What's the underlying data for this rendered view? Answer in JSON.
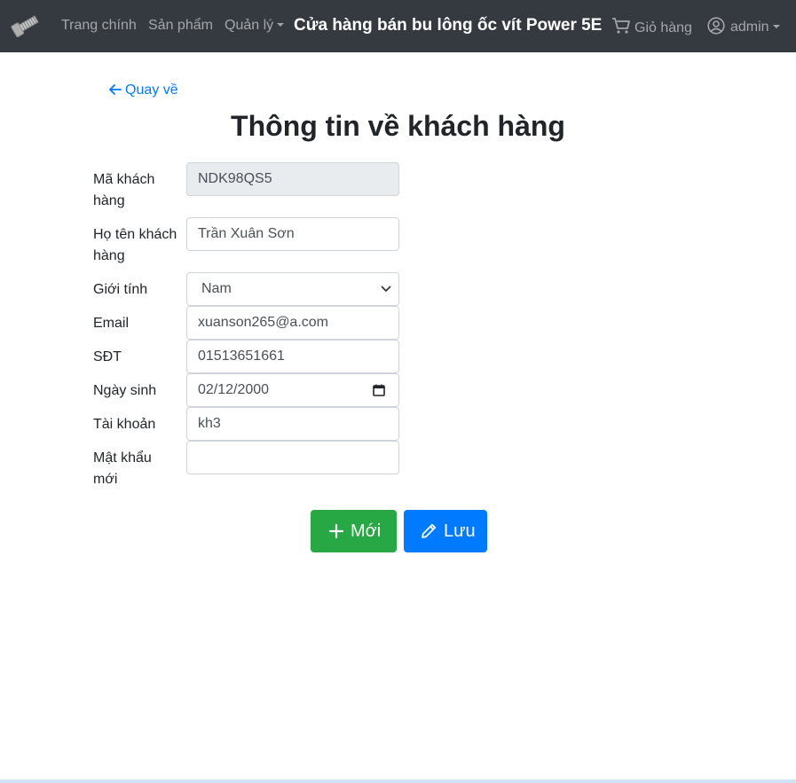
{
  "nav": {
    "home": "Trang chính",
    "products": "Sản phẩm",
    "manage": "Quản lý",
    "brand": "Cửa hàng bán bu lông ốc vít Power 5E",
    "cart": "Giỏ hàng",
    "user": "admin"
  },
  "page": {
    "back": "Quay về",
    "title": "Thông tin về khách hàng"
  },
  "form": {
    "customer_id": {
      "label": "Mã khách hàng",
      "value": "NDK98QS5"
    },
    "full_name": {
      "label": "Họ tên khách hàng",
      "value": "Trần Xuân Sơn"
    },
    "gender": {
      "label": "Giới tính",
      "value": "Nam"
    },
    "email": {
      "label": "Email",
      "value": "xuanson265@a.com"
    },
    "phone": {
      "label": "SĐT",
      "value": "01513651661"
    },
    "birthday": {
      "label": "Ngày sinh",
      "value": "02/12/2000"
    },
    "account": {
      "label": "Tài khoản",
      "value": "kh3"
    },
    "new_password": {
      "label": "Mật khẩu mới",
      "value": ""
    }
  },
  "buttons": {
    "new": "Mới",
    "save": "Lưu"
  },
  "colors": {
    "navbar": "#343a40",
    "primary": "#007bff",
    "success": "#28a745"
  }
}
